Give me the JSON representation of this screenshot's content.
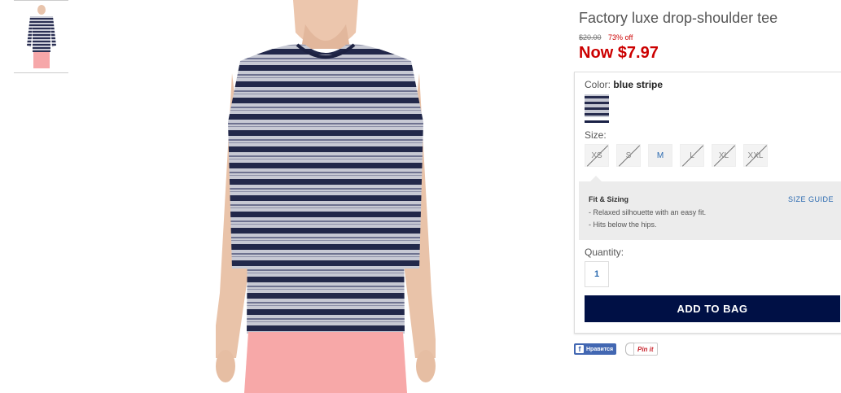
{
  "product": {
    "title": "Factory luxe drop-shoulder tee",
    "old_price": "$20.00",
    "discount": "73% off",
    "now_price": "Now $7.97"
  },
  "color": {
    "label": "Color:",
    "selected": "blue stripe"
  },
  "size": {
    "label": "Size:",
    "options": [
      {
        "label": "XS",
        "available": false
      },
      {
        "label": "S",
        "available": false
      },
      {
        "label": "M",
        "available": true
      },
      {
        "label": "L",
        "available": false
      },
      {
        "label": "XL",
        "available": false
      },
      {
        "label": "XXL",
        "available": false
      }
    ]
  },
  "fit": {
    "title": "Fit & Sizing",
    "size_guide": "SIZE GUIDE",
    "lines": [
      "- Relaxed silhouette with an easy fit.",
      "- Hits below the hips."
    ]
  },
  "quantity": {
    "label": "Quantity:",
    "value": "1"
  },
  "add_to_bag": "ADD TO BAG",
  "social": {
    "facebook": "Нравится",
    "pinterest": "Pin it"
  },
  "colors": {
    "price_red": "#cc0000",
    "navy_button": "#001045",
    "link_blue": "#2b6ab0"
  }
}
